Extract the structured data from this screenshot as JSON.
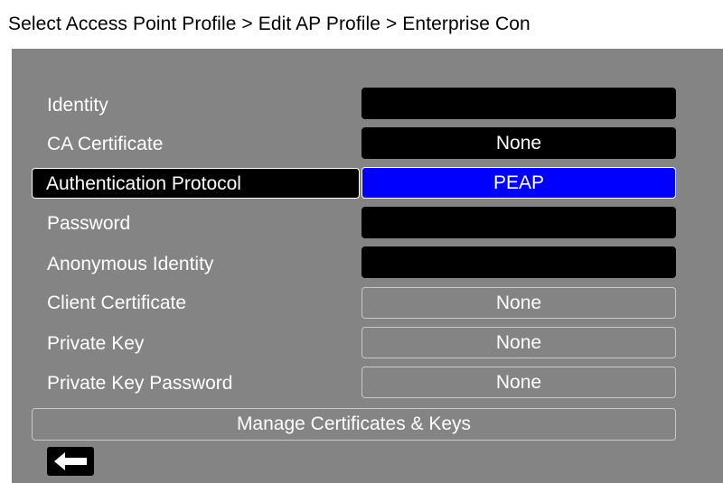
{
  "header": {
    "breadcrumb": "Select Access Point Profile > Edit AP Profile > Enterprise Con"
  },
  "form": {
    "identity": {
      "label": "Identity",
      "value": ""
    },
    "ca_certificate": {
      "label": "CA Certificate",
      "value": "None"
    },
    "authentication_protocol": {
      "label": "Authentication Protocol",
      "value": "PEAP"
    },
    "password": {
      "label": "Password",
      "value": ""
    },
    "anonymous_identity": {
      "label": "Anonymous Identity",
      "value": ""
    },
    "client_certificate": {
      "label": "Client Certificate",
      "value": "None"
    },
    "private_key": {
      "label": "Private Key",
      "value": "None"
    },
    "private_key_password": {
      "label": "Private Key Password",
      "value": "None"
    }
  },
  "actions": {
    "manage_label": "Manage Certificates & Keys",
    "back_icon": "left-arrow-icon"
  },
  "colors": {
    "panel": "#848484",
    "field_active": "#000000",
    "selected_value": "#0000ff",
    "text": "#ffffff"
  }
}
